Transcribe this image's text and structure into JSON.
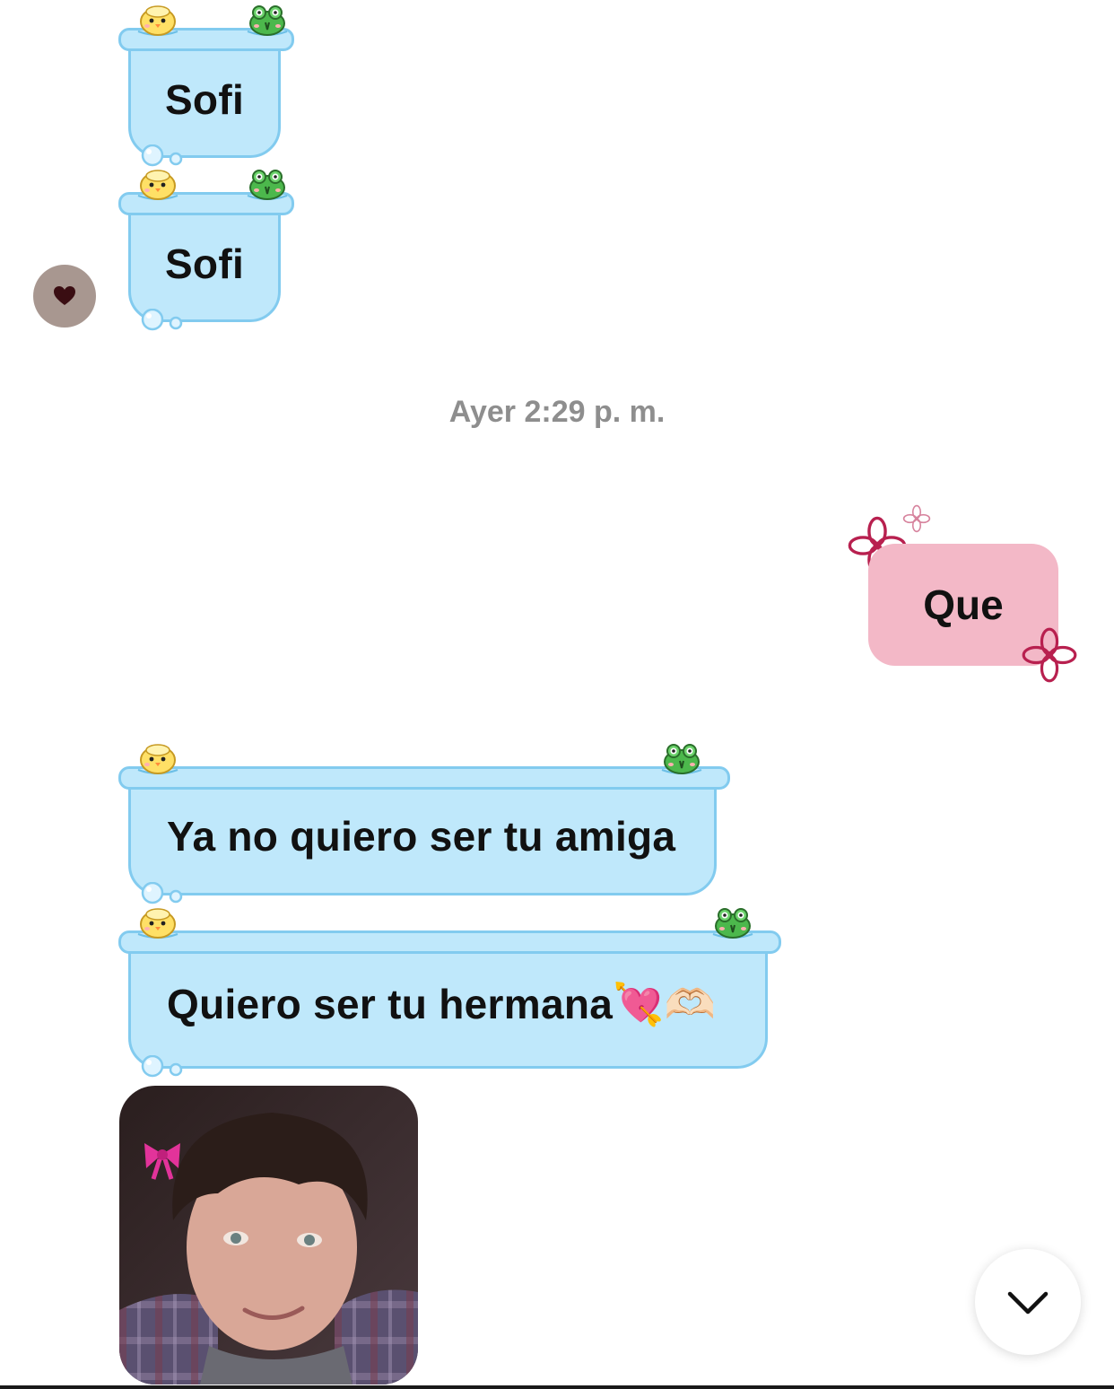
{
  "messages": [
    {
      "text": "Sofi"
    },
    {
      "text": "Sofi"
    },
    {
      "text": "Ya no quiero ser tu amiga"
    },
    {
      "text": "Quiero ser tu hermana💘🫶🏻"
    }
  ],
  "timestamp": "Ayer 2:29 p. m.",
  "outgoing": {
    "text": "Que"
  },
  "colors": {
    "incoming_bubble": "#bfe8fb",
    "incoming_border": "#82cbef",
    "outgoing_bubble": "#f3b8c7",
    "timestamp": "#8e8e8e"
  },
  "icons": {
    "avatar": "heart-icon",
    "scroll": "chevron-down-icon",
    "sticker_left": "chick-sticker-icon",
    "sticker_right": "frog-sticker-icon",
    "flower": "flower-icon"
  }
}
